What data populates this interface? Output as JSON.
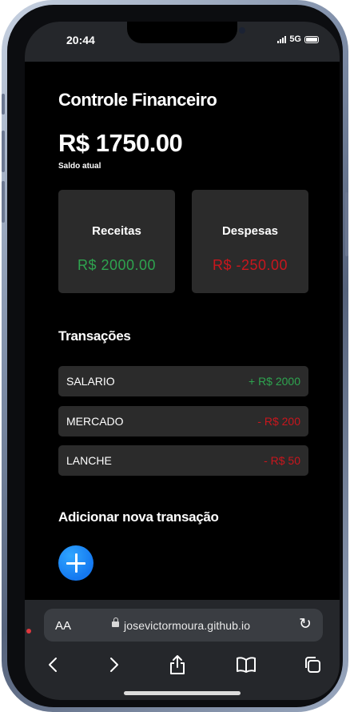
{
  "status": {
    "time": "20:44",
    "network": "5G"
  },
  "app": {
    "title": "Controle Financeiro",
    "balance": "R$ 1750.00",
    "balance_label": "Saldo atual",
    "income": {
      "label": "Receitas",
      "value": "R$ 2000.00",
      "color": "#2ea44f"
    },
    "expense": {
      "label": "Despesas",
      "value": "R$ -250.00",
      "color": "#c8161d"
    },
    "transactions_title": "Transações",
    "transactions": [
      {
        "name": "SALARIO",
        "amount": "+ R$ 2000",
        "type": "income"
      },
      {
        "name": "MERCADO",
        "amount": "- R$ 200",
        "type": "expense"
      },
      {
        "name": "LANCHE",
        "amount": "- R$ 50",
        "type": "expense"
      }
    ],
    "add_title": "Adicionar nova transação",
    "add_icon": "plus-icon"
  },
  "browser": {
    "text_size_label": "AA",
    "url": "josevictormoura.github.io",
    "toolbar_icons": [
      "back-icon",
      "forward-icon",
      "share-icon",
      "bookmarks-icon",
      "tabs-icon"
    ]
  }
}
